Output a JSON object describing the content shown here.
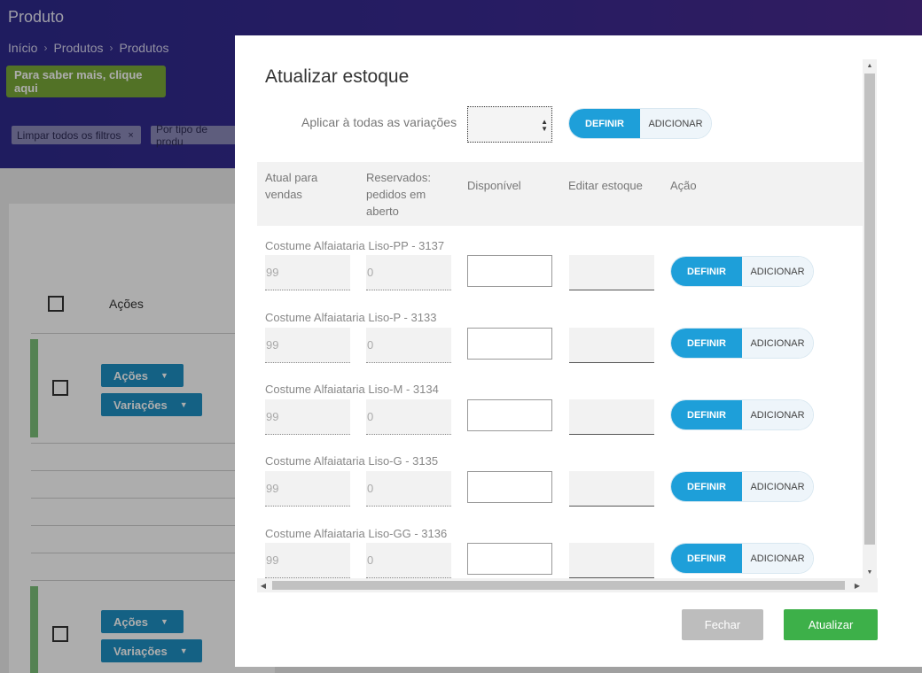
{
  "page": {
    "title": "Produto",
    "breadcrumb": [
      "Início",
      "Produtos",
      "Produtos"
    ],
    "learn_more": "Para saber mais, clique aqui",
    "filter_chips": [
      "Limpar todos os filtros",
      "Por tipo de produ"
    ],
    "chip_close": "×",
    "table_actions_header": "Ações",
    "row_actions_label": "Ações",
    "row_variations_label": "Variações"
  },
  "modal": {
    "title": "Atualizar estoque",
    "apply_all_label": "Aplicar à todas as variações",
    "apply_all_value": "",
    "define_label": "DEFINIR",
    "add_label": "ADICIONAR",
    "columns": [
      "Atual para vendas",
      "Reservados: pedidos em aberto",
      "Disponível",
      "Editar estoque",
      "Ação"
    ],
    "rows": [
      {
        "name": "Costume Alfaiataria Liso-PP - 3137",
        "current": "99",
        "reserved": "0"
      },
      {
        "name": "Costume Alfaiataria Liso-P - 3133",
        "current": "99",
        "reserved": "0"
      },
      {
        "name": "Costume Alfaiataria Liso-M - 3134",
        "current": "99",
        "reserved": "0"
      },
      {
        "name": "Costume Alfaiataria Liso-G - 3135",
        "current": "99",
        "reserved": "0"
      },
      {
        "name": "Costume Alfaiataria Liso-GG - 3136",
        "current": "99",
        "reserved": "0"
      }
    ],
    "close_button": "Fechar",
    "update_button": "Atualizar"
  },
  "colors": {
    "header_bg": "#3a2a92",
    "define_blue": "#1e9fd9",
    "update_green": "#3db049",
    "close_gray": "#bdbdbd"
  }
}
